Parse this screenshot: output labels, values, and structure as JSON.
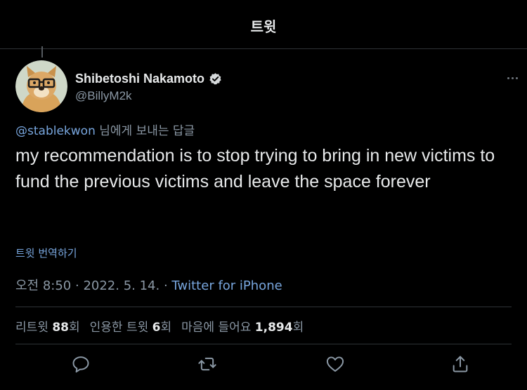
{
  "header": {
    "title": "트윗"
  },
  "author": {
    "name": "Shibetoshi Nakamoto",
    "handle": "@BillyM2k",
    "verified": true,
    "avatar_icon": "doge-with-glasses-avatar"
  },
  "reply": {
    "mention": "@stablekwon",
    "suffix": " 님에게 보내는 답글"
  },
  "tweet": {
    "text": "my recommendation is to stop trying to bring in new victims to fund the previous victims and leave the space forever",
    "translate_label": "트윗 번역하기"
  },
  "meta": {
    "time": "오전 8:50",
    "sep1": " · ",
    "date": "2022. 5. 14.",
    "sep2": " · ",
    "source": "Twitter for iPhone"
  },
  "stats": {
    "retweets_label": "리트윗 ",
    "retweets_count": "88",
    "retweets_unit": "회",
    "quotes_label": "인용한 트윗 ",
    "quotes_count": "6",
    "quotes_unit": "회",
    "likes_label": "마음에 들어요 ",
    "likes_count": "1,894",
    "likes_unit": "회"
  },
  "actions": [
    "reply-icon",
    "retweet-icon",
    "like-icon",
    "share-icon"
  ],
  "colors": {
    "background": "#000000",
    "text": "#e7e9ea",
    "secondary": "#8b98a5",
    "link": "#78a6de",
    "divider": "#2f3336"
  }
}
